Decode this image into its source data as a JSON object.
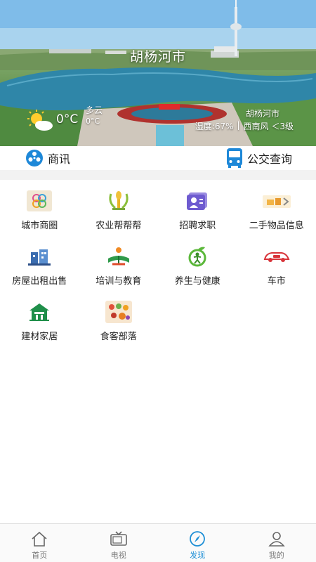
{
  "banner": {
    "city_title": "胡杨河市",
    "weather": {
      "temperature": "0°C",
      "condition": "多云",
      "condition_temp": "0°C",
      "city": "胡杨河市",
      "humidity": "湿度:67%",
      "separator": "|",
      "wind": "西南风 ＜3级"
    }
  },
  "quickbar": {
    "news_label": "商讯",
    "bus_label": "公交查询"
  },
  "categories": [
    {
      "label": "城市商圈",
      "icon": "city-business-icon"
    },
    {
      "label": "农业帮帮帮",
      "icon": "agriculture-icon"
    },
    {
      "label": "招聘求职",
      "icon": "recruitment-icon"
    },
    {
      "label": "二手物品信息",
      "icon": "secondhand-icon"
    },
    {
      "label": "房屋出租出售",
      "icon": "house-rental-icon"
    },
    {
      "label": "培训与教育",
      "icon": "education-icon"
    },
    {
      "label": "养生与健康",
      "icon": "health-icon"
    },
    {
      "label": "车市",
      "icon": "car-market-icon"
    },
    {
      "label": "建材家居",
      "icon": "building-materials-icon"
    },
    {
      "label": "食客部落",
      "icon": "food-icon"
    }
  ],
  "tabs": [
    {
      "label": "首页",
      "icon": "home-icon"
    },
    {
      "label": "电视",
      "icon": "tv-icon"
    },
    {
      "label": "发现",
      "icon": "compass-icon",
      "active": true
    },
    {
      "label": "我的",
      "icon": "user-icon"
    }
  ],
  "colors": {
    "accent": "#1e8fd6",
    "bus_icon": "#1e88d8",
    "tab_inactive": "#777777"
  }
}
